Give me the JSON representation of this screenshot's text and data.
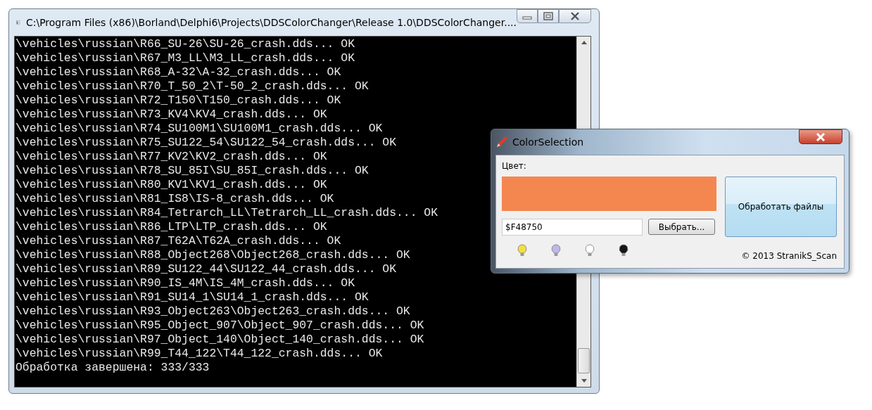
{
  "console_window": {
    "title": "C:\\Program Files (x86)\\Borland\\Delphi6\\Projects\\DDSColorChanger\\Release 1.0\\DDSColorChanger....",
    "lines": [
      "\\vehicles\\russian\\R66_SU-26\\SU-26_crash.dds... OK",
      "\\vehicles\\russian\\R67_M3_LL\\M3_LL_crash.dds... OK",
      "\\vehicles\\russian\\R68_A-32\\A-32_crash.dds... OK",
      "\\vehicles\\russian\\R70_T_50_2\\T-50_2_crash.dds... OK",
      "\\vehicles\\russian\\R72_T150\\T150_crash.dds... OK",
      "\\vehicles\\russian\\R73_KV4\\KV4_crash.dds... OK",
      "\\vehicles\\russian\\R74_SU100M1\\SU100M1_crash.dds... OK",
      "\\vehicles\\russian\\R75_SU122_54\\SU122_54_crash.dds... OK",
      "\\vehicles\\russian\\R77_KV2\\KV2_crash.dds... OK",
      "\\vehicles\\russian\\R78_SU_85I\\SU_85I_crash.dds... OK",
      "\\vehicles\\russian\\R80_KV1\\KV1_crash.dds... OK",
      "\\vehicles\\russian\\R81_IS8\\IS-8_crash.dds... OK",
      "\\vehicles\\russian\\R84_Tetrarch_LL\\Tetrarch_LL_crash.dds... OK",
      "\\vehicles\\russian\\R86_LTP\\LTP_crash.dds... OK",
      "\\vehicles\\russian\\R87_T62A\\T62A_crash.dds... OK",
      "\\vehicles\\russian\\R88_Object268\\Object268_crash.dds... OK",
      "\\vehicles\\russian\\R89_SU122_44\\SU122_44_crash.dds... OK",
      "\\vehicles\\russian\\R90_IS_4M\\IS_4M_crash.dds... OK",
      "\\vehicles\\russian\\R91_SU14_1\\SU14_1_crash.dds... OK",
      "\\vehicles\\russian\\R93_Object263\\Object263_crash.dds... OK",
      "\\vehicles\\russian\\R95_Object_907\\Object_907_crash.dds... OK",
      "\\vehicles\\russian\\R97_Object_140\\Object_140_crash.dds... OK",
      "\\vehicles\\russian\\R99_T44_122\\T44_122_crash.dds... OK",
      "Обработка завершена: 333/333"
    ]
  },
  "color_dialog": {
    "title": "ColorSelection",
    "color_label": "Цвет:",
    "color": "#f48750",
    "hex_field": {
      "value": "$F48750"
    },
    "pick_button": "Выбрать...",
    "process_button": "Обработать файлы",
    "presets": [
      {
        "color": "#f2e040"
      },
      {
        "color": "#bdb8e8"
      },
      {
        "color": "#ffffff"
      },
      {
        "color": "#151515"
      }
    ],
    "copyright": "© 2013 StranikS_Scan"
  }
}
